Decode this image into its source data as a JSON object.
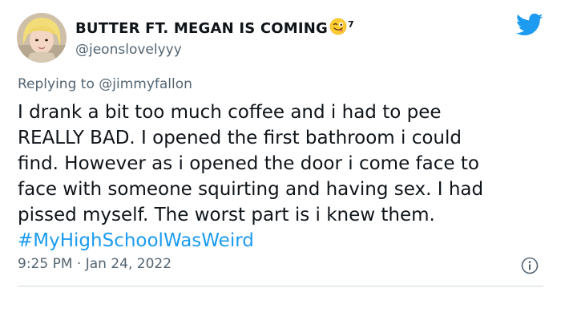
{
  "user": {
    "display_name": "BUTTER FT. MEGAN IS COMING",
    "name_superscript": "7",
    "handle": "@jeonslovelyyy"
  },
  "reply": {
    "prefix": "Replying to",
    "mention": "@jimmyfallon"
  },
  "tweet": {
    "lines": [
      "I drank a bit too much coffee and i had to pee",
      "REALLY BAD. I opened the first bathroom i could",
      "find. However as i opened the door i come face to",
      "face with someone squirting and having sex. I had",
      "pissed myself. The worst part is i knew them."
    ],
    "hashtag": "#MyHighSchoolWasWeird"
  },
  "meta": {
    "timestamp": "9:25 PM · Jan 24, 2022"
  },
  "icons": {
    "brand": "twitter-bird-icon",
    "emoji": "winking-tongue-emoji",
    "info": "info-icon"
  },
  "colors": {
    "brand": "#1d9bf0",
    "text": "#0f1419",
    "muted": "#536471",
    "divider": "#cfd9de"
  }
}
